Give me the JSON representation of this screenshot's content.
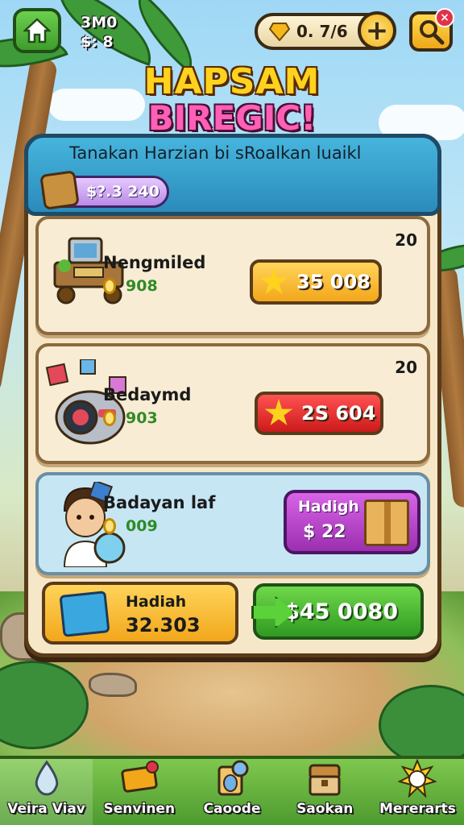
{
  "header": {
    "stat_line_1": "3M0",
    "stat_line_2": "$: 8",
    "gem_value": "0. 7/6",
    "plus_label": "+",
    "close_label": "×"
  },
  "title": {
    "line1": "HAPSAM",
    "line2": "BIREGIC!"
  },
  "panel": {
    "title": "Tanakan Harzian bi sRoalkan luaikl",
    "balance": "$?.3 240"
  },
  "items": [
    {
      "count": "20",
      "name": "Nengmiled",
      "sub_value": "908",
      "price": "35 008",
      "price_color": "yellow"
    },
    {
      "count": "20",
      "name": "Bedaymd",
      "sub_value": "903",
      "price": "2S 604",
      "price_color": "red"
    },
    {
      "name": "Badayan laf",
      "sub_value": "009",
      "gift_label": "Hadigh",
      "gift_price": "$ 22"
    }
  ],
  "bonus": {
    "label": "Hadiah",
    "value": "32.303"
  },
  "go_button": {
    "label": "$45 0080"
  },
  "nav": [
    {
      "label": "Veira Viav",
      "icon": "drop-icon"
    },
    {
      "label": "Senvinen",
      "icon": "badge-icon"
    },
    {
      "label": "Caoode",
      "icon": "potion-icon"
    },
    {
      "label": "Saokan",
      "icon": "chest-icon"
    },
    {
      "label": "Mererarts",
      "icon": "sun-icon"
    }
  ],
  "colors": {
    "accent_green": "#3f9c2d",
    "accent_yellow": "#f2a71b",
    "accent_red": "#cc1a1a",
    "accent_purple": "#9b2fb0",
    "header_blue": "#2b8bbb"
  }
}
